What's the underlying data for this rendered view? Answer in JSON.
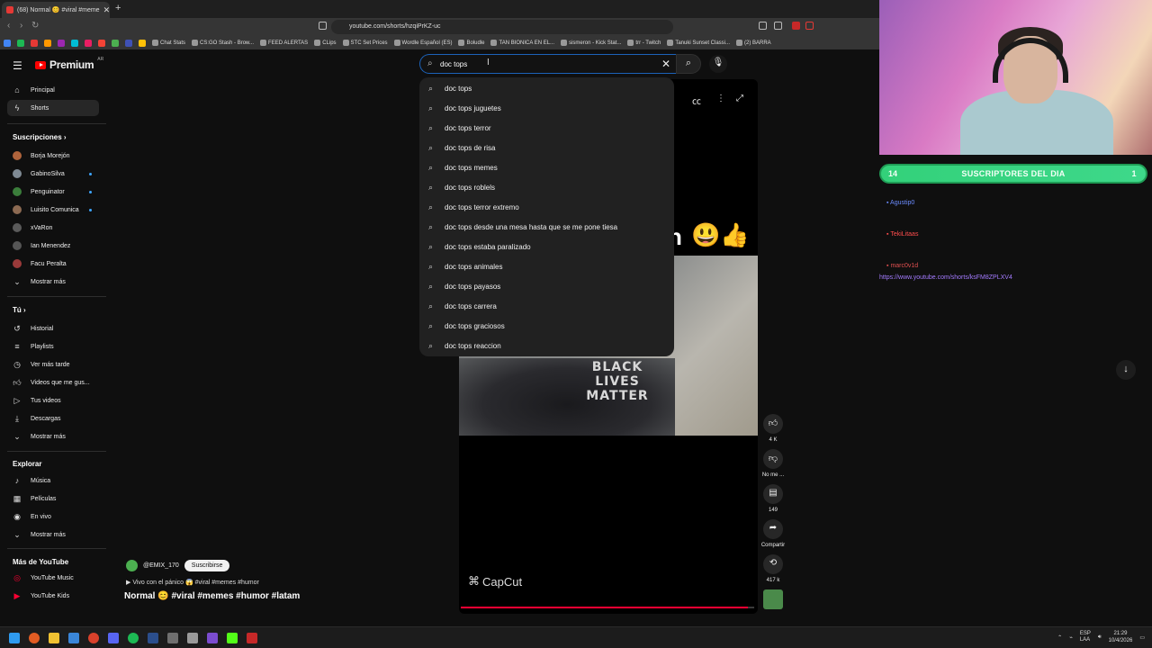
{
  "browser": {
    "tab_title": "(68) Normal 😊 #viral #meme",
    "url": "youtube.com/shorts/hzqiPrKZ-uc",
    "bookmarks": [
      "Chat Stats",
      "CS:GO Stash - Brow...",
      "FEED ALERTAS",
      "CLips",
      "STC Set Prices",
      "Wordle Español (ES)",
      "Boludle",
      "TAN BIONICA EN EL...",
      "sismeron - Kick Stat...",
      "trr - Twitch",
      "Tanuki Sunset Classi...",
      "(2) BARRA"
    ]
  },
  "header": {
    "logo_text": "Premium",
    "country": "AR",
    "search_value": "doc tops"
  },
  "suggestions": [
    "doc tops",
    "doc tops juguetes",
    "doc tops terror",
    "doc tops de risa",
    "doc tops memes",
    "doc tops roblels",
    "doc tops terror extremo",
    "doc tops desde una mesa hasta que se me pone tiesa",
    "doc tops estaba paralizado",
    "doc tops animales",
    "doc tops payasos",
    "doc tops carrera",
    "doc tops graciosos",
    "doc tops reaccion"
  ],
  "sidebar": {
    "main": [
      {
        "label": "Principal",
        "icon": "home-icon"
      },
      {
        "label": "Shorts",
        "icon": "shorts-icon"
      }
    ],
    "subs_heading": "Suscripciones",
    "subs": [
      {
        "label": "Borja Morejón",
        "color": "#b0643c",
        "dot": false
      },
      {
        "label": "GabinoSilva",
        "color": "#7f8a94",
        "dot": true
      },
      {
        "label": "Penguinator",
        "color": "#3b7d3b",
        "dot": true
      },
      {
        "label": "Luisito Comunica",
        "color": "#8c6a52",
        "dot": true
      },
      {
        "label": "xVaRon",
        "color": "#5a5a5a",
        "dot": false
      },
      {
        "label": "Ian Menendez",
        "color": "#555555",
        "dot": false
      },
      {
        "label": "Facu Peralta",
        "color": "#9a3a3a",
        "dot": false
      },
      {
        "label": "Mostrar más",
        "color": "",
        "dot": false
      }
    ],
    "you_heading": "Tú",
    "you": [
      {
        "label": "Historial",
        "icon": "history-icon"
      },
      {
        "label": "Playlists",
        "icon": "playlist-icon"
      },
      {
        "label": "Ver más tarde",
        "icon": "clock-icon"
      },
      {
        "label": "Videos que me gus...",
        "icon": "like-icon"
      },
      {
        "label": "Tus videos",
        "icon": "video-icon"
      },
      {
        "label": "Descargas",
        "icon": "download-icon"
      },
      {
        "label": "Mostrar más",
        "icon": "chevron-down-icon"
      }
    ],
    "explore_heading": "Explorar",
    "explore": [
      {
        "label": "Música",
        "icon": "music-icon"
      },
      {
        "label": "Películas",
        "icon": "film-icon"
      },
      {
        "label": "En vivo",
        "icon": "live-icon"
      },
      {
        "label": "Mostrar más",
        "icon": "chevron-down-icon"
      }
    ],
    "more_heading": "Más de YouTube",
    "more": [
      {
        "label": "YouTube Music",
        "icon": "yt-music-icon"
      },
      {
        "label": "YouTube Kids",
        "icon": "yt-kids-icon"
      }
    ]
  },
  "video": {
    "overlay_caption": "n",
    "shirt_text": "BLACK LIVES MATTER",
    "watermark": "CapCut",
    "progress_fraction": 0.98
  },
  "rail": {
    "likes": "4 K",
    "dislike": "No me ...",
    "comments": "149",
    "share": "Compartir",
    "remix": "417 k"
  },
  "channel": {
    "handle": "@EMIX_170",
    "subscribe": "Suscribirse",
    "song": "Vivo con el pánico 😱 #viral #memes #humor",
    "title": "Normal 😊 #viral #memes #humor #latam"
  },
  "stream": {
    "subs_left": "14",
    "subs_title": "SUSCRIPTORES DEL DIA",
    "subs_right": "1",
    "chat": [
      {
        "user": "Agustip0",
        "color": "#6b8cff",
        "text": ""
      },
      {
        "user": "TekiLitaas",
        "color": "#ff4d4d",
        "text": ""
      },
      {
        "user": "marc0v1d",
        "color": "#e05050",
        "text": ""
      }
    ],
    "link": "https://www.youtube.com/shorts/ksFM8ZPLXV4"
  },
  "taskbar": {
    "lang": "ESP\nLAA",
    "time": "21:29",
    "date": "10/4/2026"
  },
  "colors": {
    "accent_red": "#ff0000",
    "search_focus": "#1c62b9",
    "subs_green": "#33d17a"
  }
}
